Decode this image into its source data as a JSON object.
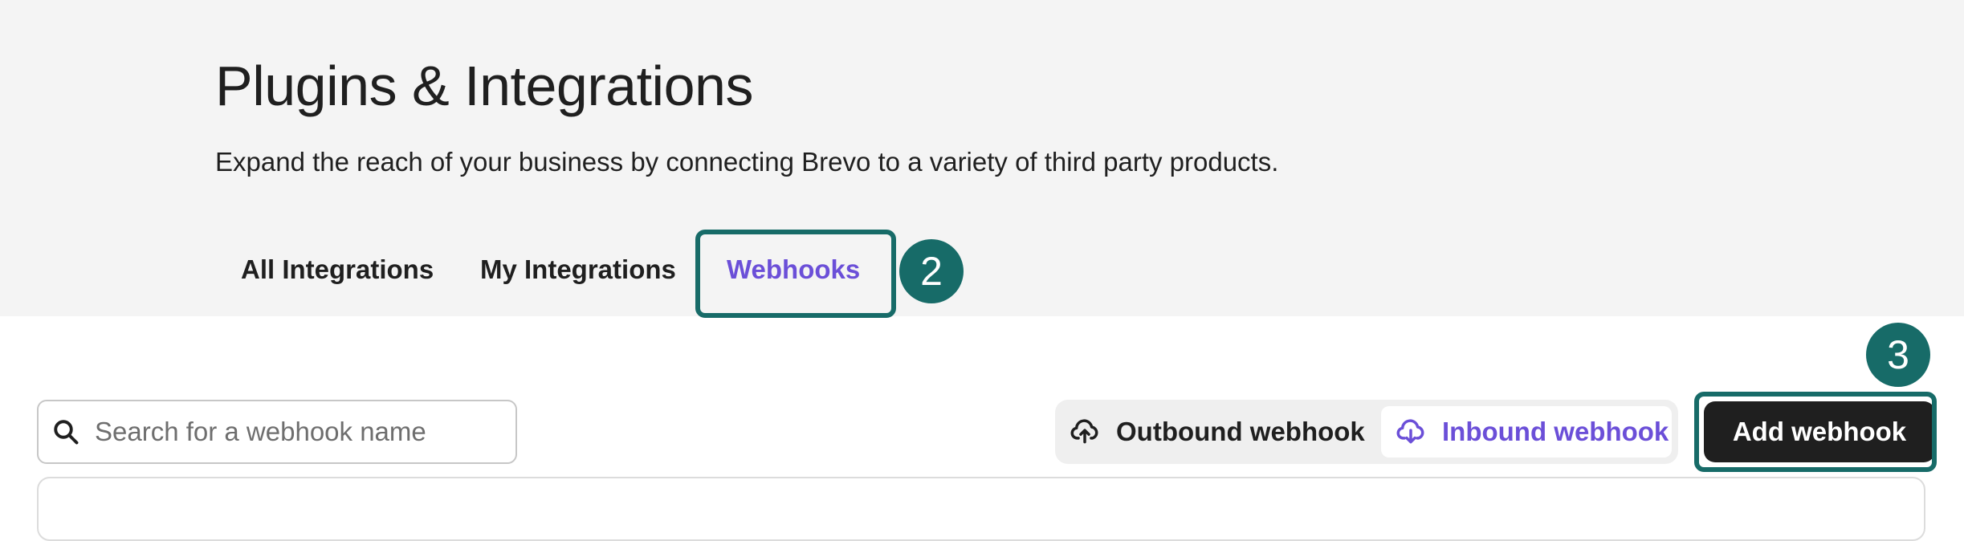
{
  "header": {
    "title": "Plugins & Integrations",
    "subtitle": "Expand the reach of your business by connecting Brevo to a variety of third party products."
  },
  "tabs": [
    {
      "label": "All Integrations",
      "active": false
    },
    {
      "label": "My Integrations",
      "active": false
    },
    {
      "label": "Webhooks",
      "active": true
    }
  ],
  "annotations": {
    "step_webhooks": "2",
    "step_add": "3",
    "color": "#176b68"
  },
  "search": {
    "placeholder": "Search for a webhook name",
    "value": "",
    "icon": "search-icon"
  },
  "webhook_type_toggle": {
    "outbound_label": "Outbound webhook",
    "outbound_icon": "cloud-upload-icon",
    "inbound_label": "Inbound webhook",
    "inbound_icon": "cloud-download-icon",
    "selected": "inbound"
  },
  "actions": {
    "add_webhook_label": "Add webhook"
  },
  "colors": {
    "accent": "#6b4fd8",
    "header_bg": "#f4f4f4",
    "primary_button": "#1f1f1f",
    "annotation": "#176b68"
  }
}
